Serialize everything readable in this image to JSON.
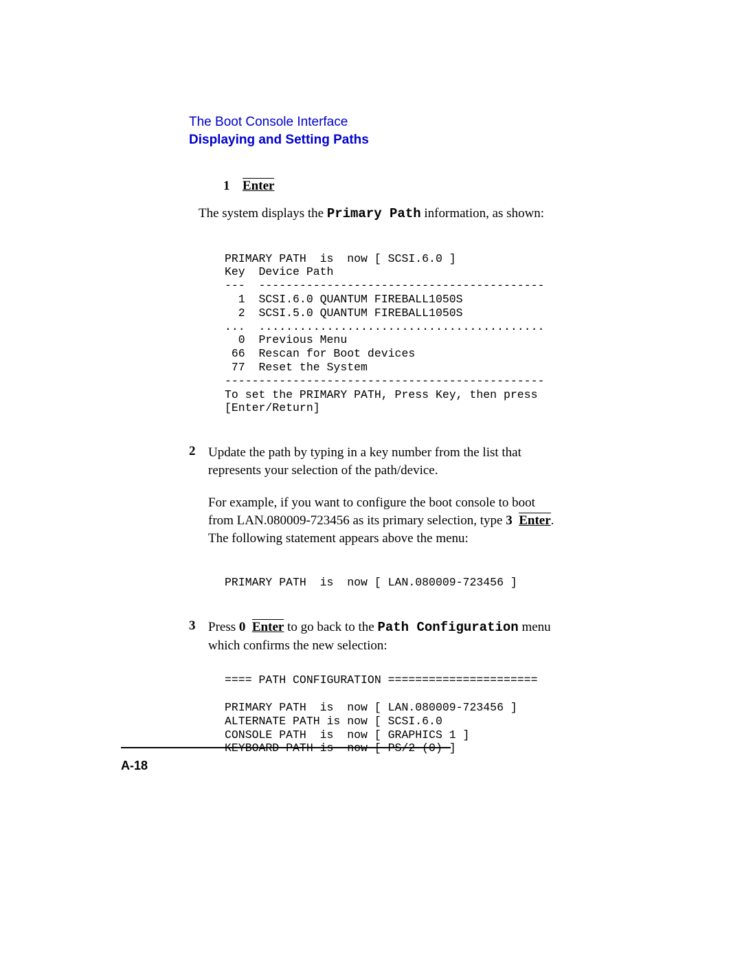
{
  "header": {
    "chapter": "The Boot Console Interface",
    "section": "Displaying and Setting Paths"
  },
  "steps": {
    "s1": {
      "num": "1",
      "enter": "Enter",
      "intro_a": "The system displays the ",
      "intro_b": "Primary Path",
      "intro_c": " information, as shown:"
    },
    "s2": {
      "num": "2",
      "p1": "Update the path by typing in a key number from the list that represents your selection of the path/device.",
      "p2a": "For example, if you want to configure the boot console to boot from LAN.080009-723456 as its primary selection, type ",
      "p2b": "3",
      "p2c": "Enter",
      "p2d": ". The following statement appears above the menu:"
    },
    "s3": {
      "num": "3",
      "a": "Press ",
      "b": "0",
      "c": "Enter",
      "d": " to go back to the ",
      "e": "Path Configuration",
      "f": " menu which confirms the new selection:"
    }
  },
  "code": {
    "block1": "PRIMARY PATH  is  now [ SCSI.6.0 ]\nKey  Device Path\n---  ------------------------------------------\n  1  SCSI.6.0 QUANTUM FIREBALL1050S\n  2  SCSI.5.0 QUANTUM FIREBALL1050S\n...  ..........................................\n  0  Previous Menu\n 66  Rescan for Boot devices\n 77  Reset the System\n-----------------------------------------------\nTo set the PRIMARY PATH, Press Key, then press\n[Enter/Return]",
    "block2": "PRIMARY PATH  is  now [ LAN.080009-723456 ]",
    "block3": "==== PATH CONFIGURATION ======================\n\nPRIMARY PATH  is  now [ LAN.080009-723456 ]\nALTERNATE PATH is now [ SCSI.6.0\nCONSOLE PATH  is  now [ GRAPHICS 1 ]\nKEYBOARD PATH is  now [ PS/2 (0) ]"
  },
  "footer": {
    "page": "A-18"
  }
}
